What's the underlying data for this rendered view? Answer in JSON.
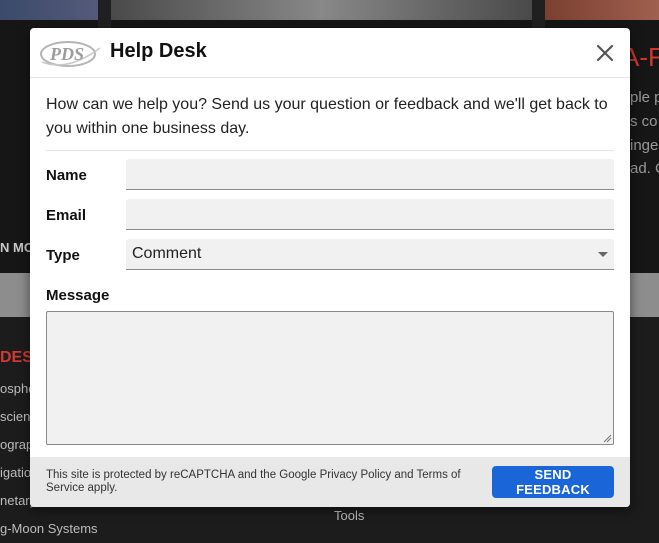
{
  "background": {
    "nav_label": "N MO",
    "card_title": "A-F",
    "card_lines": [
      "ple p",
      "s co",
      "inge",
      "ad. C"
    ],
    "footer_heading": "DES",
    "footer_links": [
      "osphe",
      "scien",
      "ograp",
      "igatio",
      "netary",
      "g-Moon Systems"
    ],
    "footer_right_link": "Tools"
  },
  "modal": {
    "logo_text": "PDS",
    "title": "Help Desk",
    "intro": "How can we help you? Send us your question or feedback and we'll get back to you within one business day.",
    "form": {
      "name_label": "Name",
      "name_value": "",
      "email_label": "Email",
      "email_value": "",
      "type_label": "Type",
      "type_selected": "Comment",
      "message_label": "Message",
      "message_value": ""
    },
    "footer": {
      "legal": "This site is protected by reCAPTCHA and the Google Privacy Policy and Terms of Service apply.",
      "send_label": "SEND FEEDBACK"
    }
  },
  "colors": {
    "accent": "#1a66d9",
    "background_red": "#d03a32"
  }
}
